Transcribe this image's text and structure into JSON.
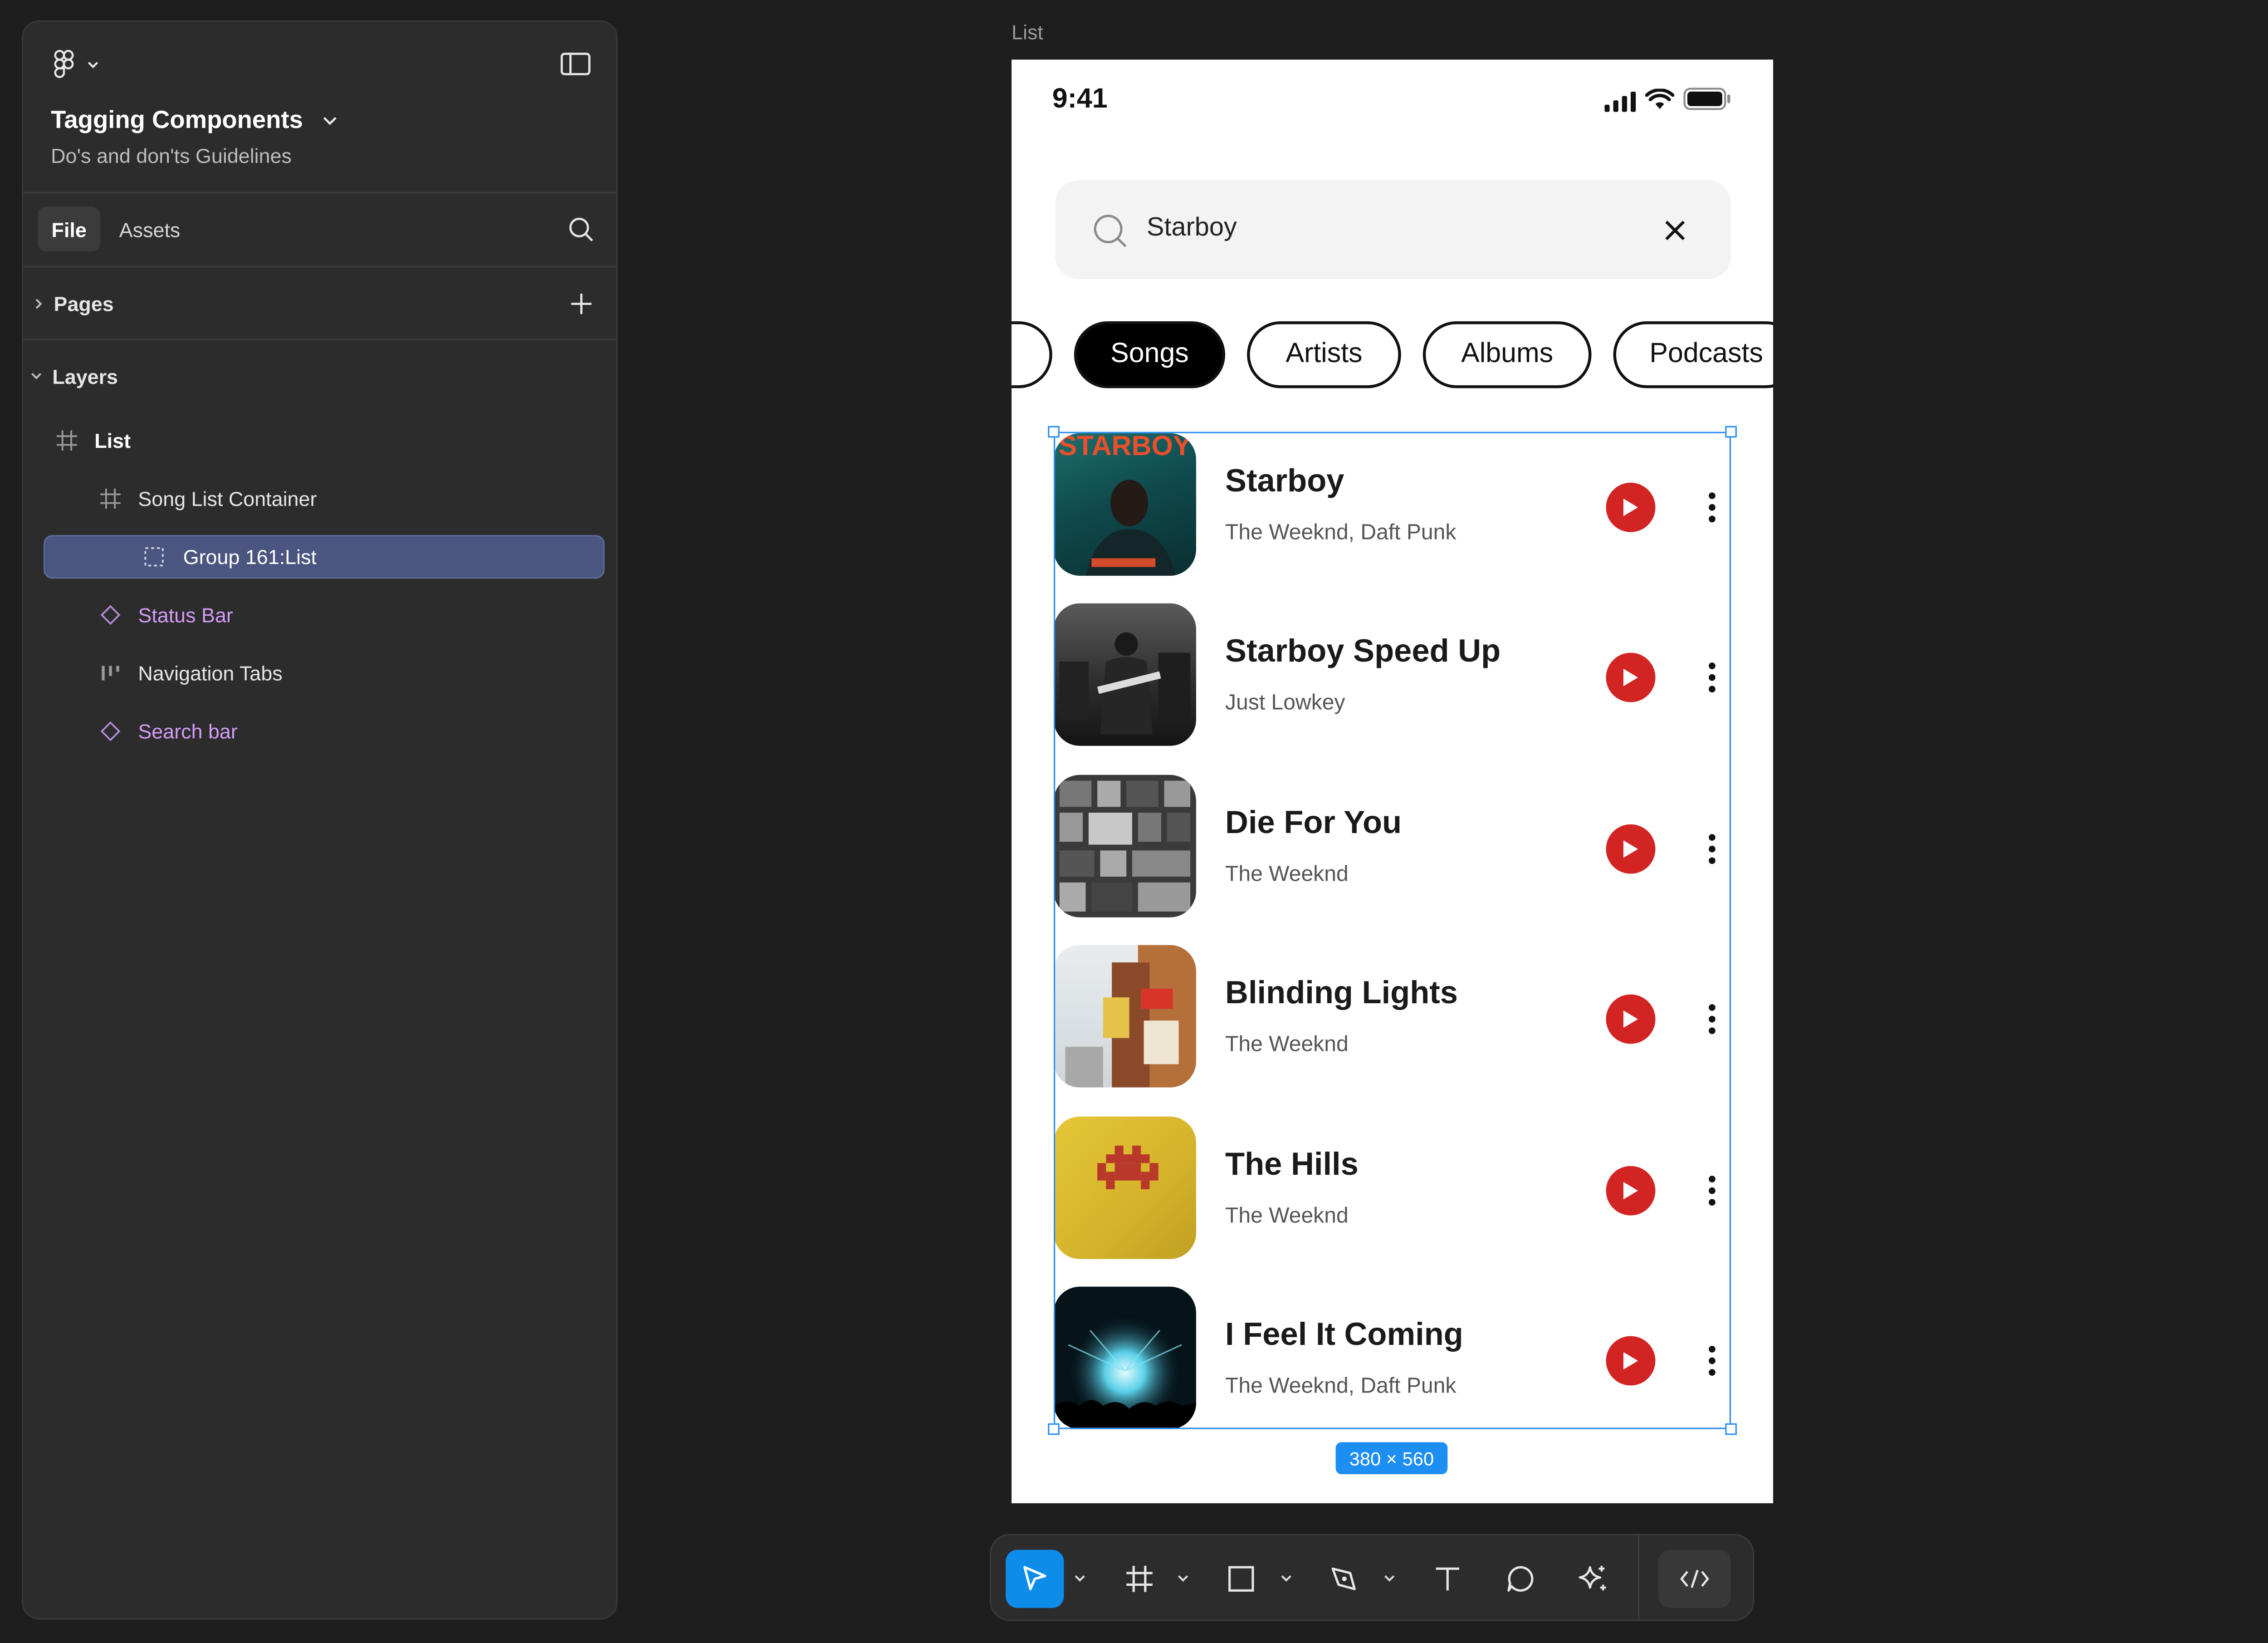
{
  "sidebar": {
    "project_title": "Tagging Components",
    "project_subtitle": "Do's and don'ts Guidelines",
    "tabs": [
      {
        "label": "File",
        "active": true
      },
      {
        "label": "Assets",
        "active": false
      }
    ],
    "pages_label": "Pages",
    "layers_label": "Layers",
    "layers": [
      {
        "label": "List",
        "icon": "frame-icon",
        "bold": true
      },
      {
        "label": "Song List Container",
        "icon": "frame-icon"
      },
      {
        "label": "Group 161:List",
        "icon": "group-icon",
        "selected": true
      },
      {
        "label": "Status Bar",
        "icon": "component-icon",
        "purple": true
      },
      {
        "label": "Navigation Tabs",
        "icon": "auto-layout-icon"
      },
      {
        "label": "Search bar",
        "icon": "component-icon",
        "purple": true
      }
    ]
  },
  "canvas": {
    "frame_label": "List",
    "selection_size": "380 × 560"
  },
  "phone": {
    "status_time": "9:41",
    "search_value": "Starboy",
    "chips": [
      {
        "label": "",
        "active": false
      },
      {
        "label": "Songs",
        "active": true
      },
      {
        "label": "Artists",
        "active": false
      },
      {
        "label": "Albums",
        "active": false
      },
      {
        "label": "Podcasts",
        "active": false
      }
    ],
    "songs": [
      {
        "title": "Starboy",
        "artist": "The Weeknd, Daft Punk"
      },
      {
        "title": "Starboy Speed Up",
        "artist": "Just Lowkey"
      },
      {
        "title": "Die For You",
        "artist": "The Weeknd"
      },
      {
        "title": "Blinding Lights",
        "artist": "The Weeknd"
      },
      {
        "title": "The Hills",
        "artist": "The Weeknd"
      },
      {
        "title": "I Feel It Coming",
        "artist": "The Weeknd, Daft Punk"
      }
    ],
    "starboy_art_text": "STARBOY",
    "accent_color": "#d32424"
  },
  "toolbar": {
    "tools": [
      "move-tool",
      "frame-tool",
      "rectangle-tool",
      "pen-tool",
      "text-tool",
      "comment-tool",
      "ai-tool",
      "dev-mode-toggle"
    ]
  }
}
